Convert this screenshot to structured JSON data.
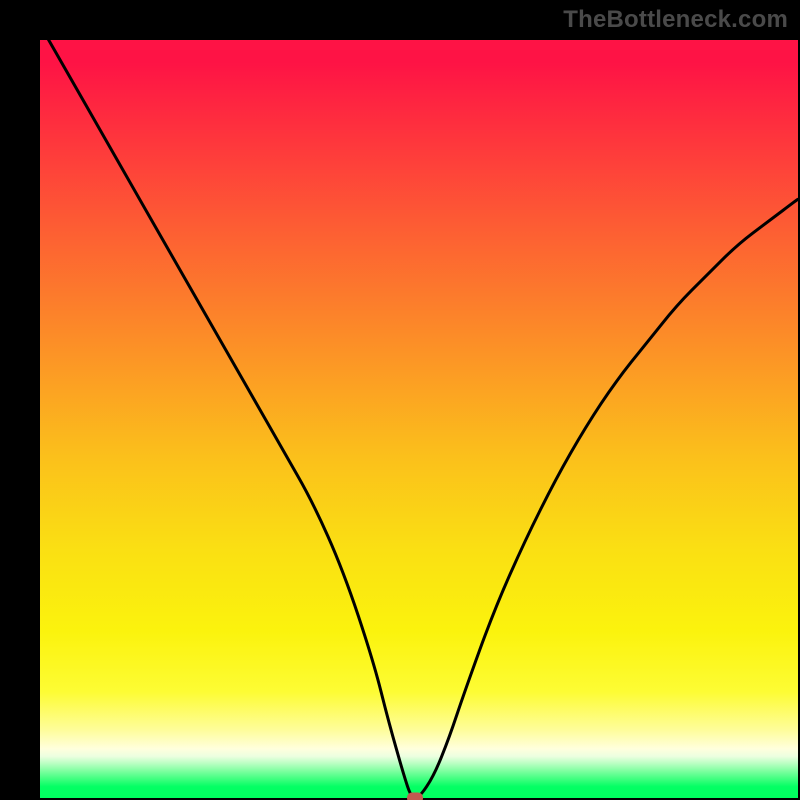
{
  "watermark": {
    "text": "TheBottleneck.com"
  },
  "chart_data": {
    "type": "line",
    "title": "",
    "xlabel": "",
    "ylabel": "",
    "xlim": [
      0,
      100
    ],
    "ylim": [
      0,
      100
    ],
    "curve": {
      "x": [
        0,
        4,
        8,
        12,
        16,
        20,
        24,
        28,
        32,
        36,
        40,
        44,
        46,
        48,
        49,
        50,
        52,
        54,
        56,
        60,
        64,
        68,
        72,
        76,
        80,
        84,
        88,
        92,
        96,
        100
      ],
      "y": [
        102,
        95,
        88,
        81,
        74,
        67,
        60,
        53,
        46,
        39,
        30,
        18,
        10,
        3,
        0,
        0,
        3,
        8,
        14,
        25,
        34,
        42,
        49,
        55,
        60,
        65,
        69,
        73,
        76,
        79
      ]
    },
    "marker": {
      "x": 49.5,
      "y": 0
    },
    "background_gradient": {
      "stops": [
        {
          "pos": 0.0,
          "color": "#fe1345"
        },
        {
          "pos": 0.25,
          "color": "#fd5e33"
        },
        {
          "pos": 0.55,
          "color": "#fbc01b"
        },
        {
          "pos": 0.86,
          "color": "#fdfc34"
        },
        {
          "pos": 0.94,
          "color": "#ffffdd"
        },
        {
          "pos": 1.0,
          "color": "#00ff5f"
        }
      ]
    }
  }
}
